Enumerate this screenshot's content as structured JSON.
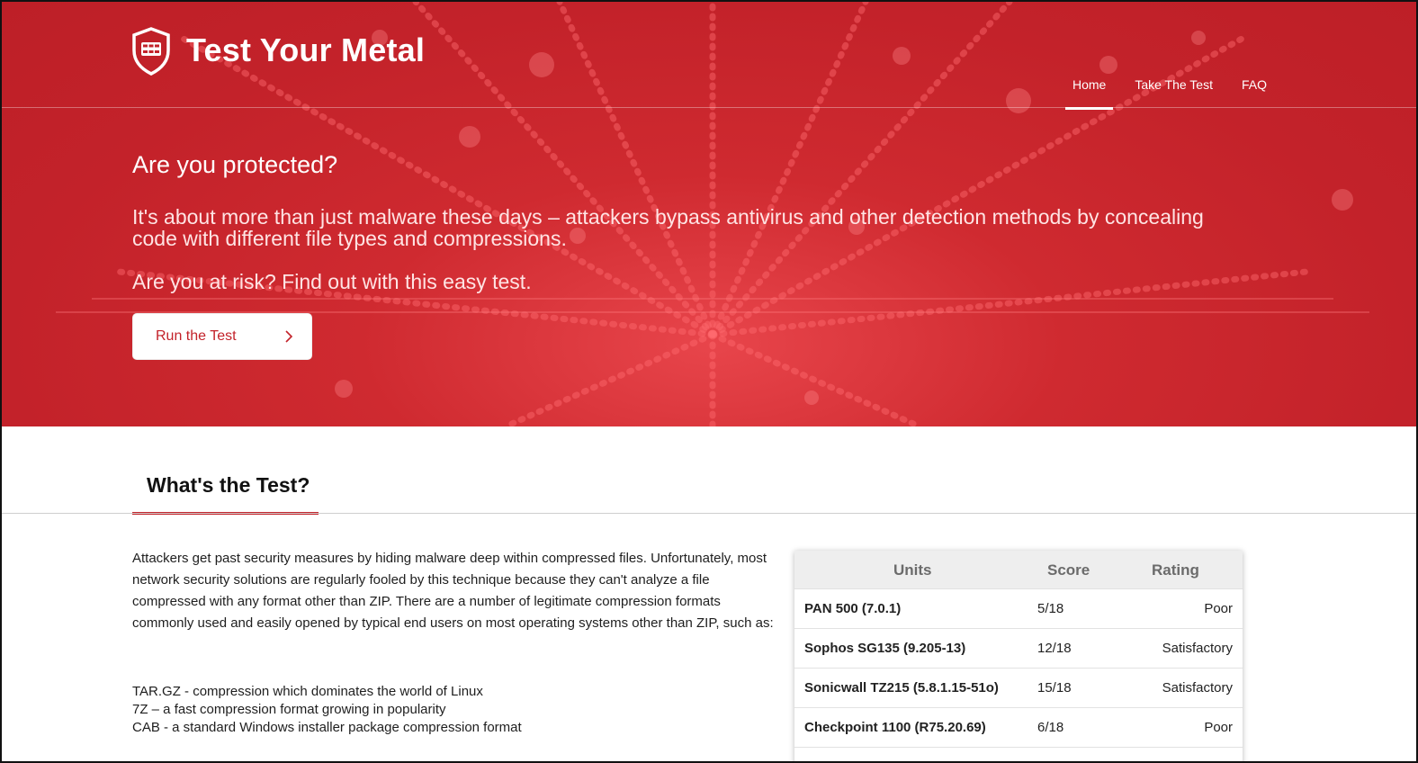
{
  "brand": {
    "name": "Test Your Metal",
    "logo_icon": "shield-grid-icon"
  },
  "nav": {
    "items": [
      {
        "label": "Home",
        "active": true
      },
      {
        "label": "Take The Test",
        "active": false
      },
      {
        "label": "FAQ",
        "active": false
      }
    ]
  },
  "hero": {
    "title": "Are you protected?",
    "lead": "It's about more than just malware these days – attackers bypass antivirus and other detection methods by concealing code with different file types and compressions.",
    "risk": "Are you at risk? Find out with this easy test.",
    "cta_label": "Run the Test",
    "cta_icon": "chevron-right-icon",
    "accent": "#c3222a"
  },
  "section": {
    "tab_label": "What's the Test?",
    "paragraph": "Attackers get past security measures by hiding malware deep within compressed files. Unfortunately, most network security solutions are regularly fooled by this technique because they can't analyze a file compressed with any format other than ZIP. There are a number of legitimate compression formats commonly used and easily opened by typical end users on most operating systems other than ZIP, such as:",
    "formats": [
      "TAR.GZ - compression which dominates the world of Linux",
      "7Z – a fast compression format growing in popularity",
      "CAB - a standard Windows installer package compression format"
    ]
  },
  "results_table": {
    "headers": {
      "units": "Units",
      "score": "Score",
      "rating": "Rating"
    },
    "rows": [
      {
        "unit": "PAN 500 (7.0.1)",
        "score": "5/18",
        "rating": "Poor"
      },
      {
        "unit": "Sophos SG135 (9.205-13)",
        "score": "12/18",
        "rating": "Satisfactory"
      },
      {
        "unit": "Sonicwall TZ215 (5.8.1.15-51o)",
        "score": "15/18",
        "rating": "Satisfactory"
      },
      {
        "unit": "Checkpoint 1100 (R75.20.69)",
        "score": "6/18",
        "rating": "Poor"
      }
    ]
  }
}
